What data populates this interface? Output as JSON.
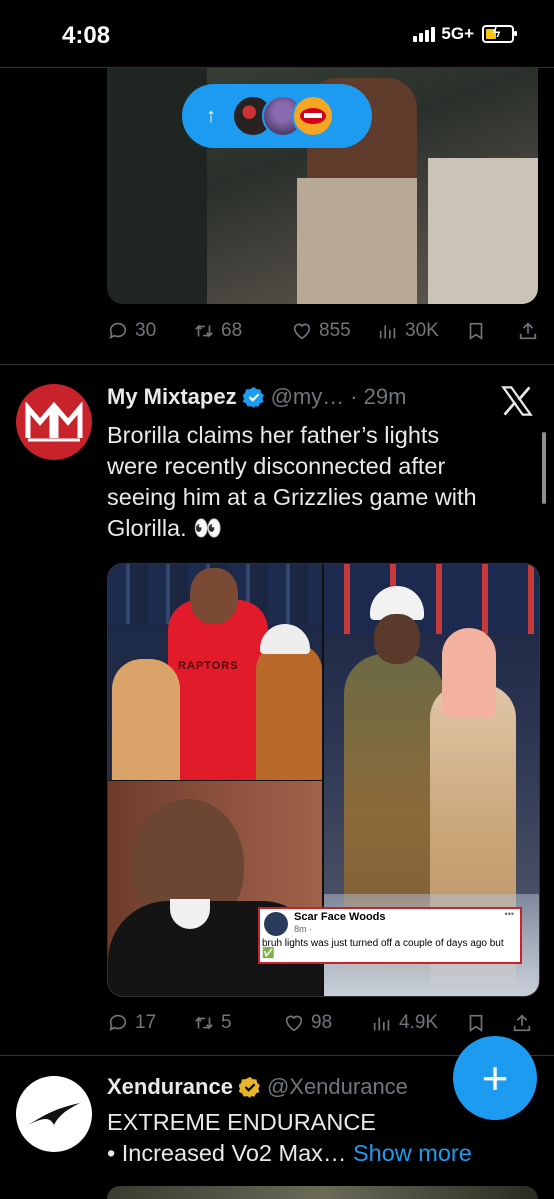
{
  "status": {
    "time": "4:08",
    "network": "5G+"
  },
  "tweet1": {
    "reply_count": "30",
    "retweet_count": "68",
    "like_count": "855",
    "view_count": "30K"
  },
  "tweet2": {
    "display_name": "My Mixtapez",
    "handle": "@my…",
    "separator": "·",
    "time_ago": "29m",
    "text_lines": [
      "Brorilla claims her father’s lights",
      "were recently disconnected after",
      "seeing him at a Grizzlies game with",
      "Glorilla. 👀"
    ],
    "reply_count": "17",
    "retweet_count": "5",
    "like_count": "98",
    "view_count": "4.9K",
    "image": {
      "shirt_text": "RAPTORS",
      "fb_author": "Scar Face Woods",
      "fb_meta": "8m ·",
      "fb_post": "bruh lights was just turned off a couple of days ago but",
      "fb_emoji": "✅",
      "fb_more": "•••"
    }
  },
  "tweet3": {
    "display_name": "Xendurance",
    "handle": "@Xendurance",
    "line1": "EXTREME ENDURANCE",
    "line2": "• Increased Vo2 Max…",
    "show_more": "Show more"
  },
  "fab": {
    "label": "+"
  },
  "colors": {
    "accent": "#1d9bf0",
    "gold_badge": "#e8b52a",
    "muted": "#71767b"
  }
}
